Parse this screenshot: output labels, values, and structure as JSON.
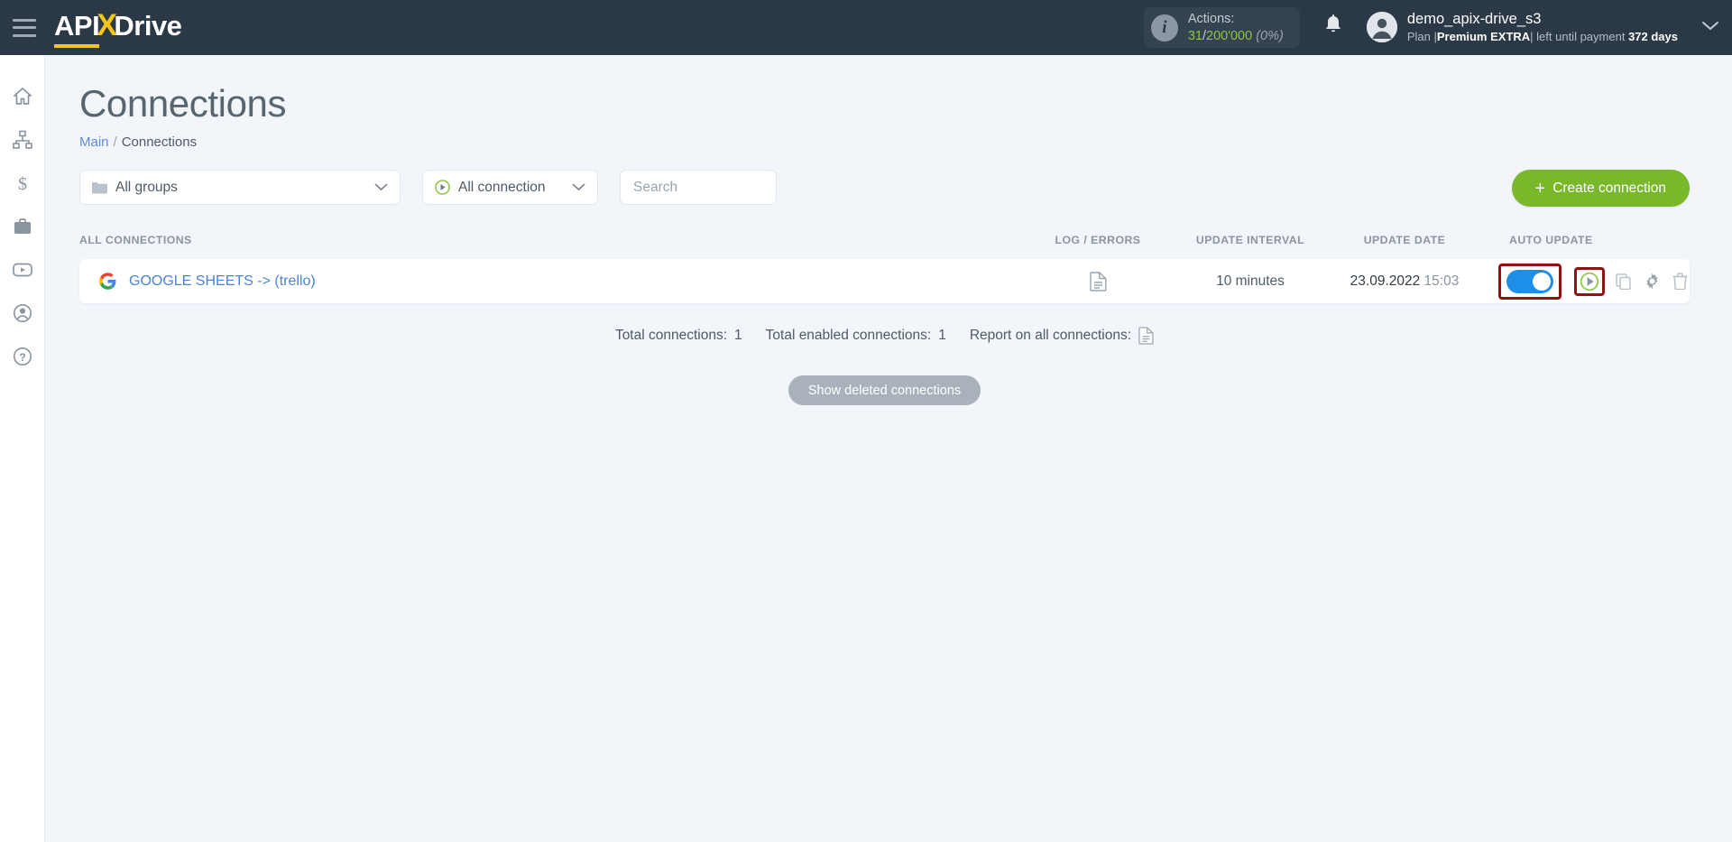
{
  "brand": {
    "part1": "API",
    "x": "X",
    "part2": "Drive",
    "accent": "#f5c518",
    "topbar_bg": "#2b3947"
  },
  "topbar": {
    "actions_label": "Actions:",
    "actions_used": "31",
    "actions_separator": "/",
    "actions_total": "200'000",
    "actions_percent": "(0%)",
    "user_name": "demo_apix-drive_s3",
    "plan_prefix": "Plan |",
    "plan_name": "Premium EXTRA",
    "plan_suffix": "| left until payment",
    "plan_days": "372 days"
  },
  "sidebar": {
    "items": [
      {
        "name": "home",
        "label": "Home"
      },
      {
        "name": "connections",
        "label": "Connections"
      },
      {
        "name": "billing",
        "label": "Billing"
      },
      {
        "name": "integrations",
        "label": "Integrations"
      },
      {
        "name": "video",
        "label": "Video"
      },
      {
        "name": "account",
        "label": "Account"
      },
      {
        "name": "help",
        "label": "Help"
      }
    ]
  },
  "page": {
    "title": "Connections",
    "breadcrumb_root": "Main",
    "breadcrumb_sep": "/",
    "breadcrumb_current": "Connections"
  },
  "filters": {
    "groups_label": "All groups",
    "connection_label": "All connection",
    "search_placeholder": "Search",
    "search_value": "",
    "create_button": "Create connection",
    "create_button_plus": "+",
    "create_button_color": "#78b82a"
  },
  "table": {
    "headers": {
      "name": "ALL CONNECTIONS",
      "log": "LOG / ERRORS",
      "interval": "UPDATE INTERVAL",
      "date": "UPDATE DATE",
      "auto": "AUTO UPDATE"
    },
    "rows": [
      {
        "name": "GOOGLE SHEETS -> (trello)",
        "source_icon": "google-icon",
        "interval": "10 minutes",
        "date": "23.09.2022",
        "time": "15:03",
        "auto_update_on": true
      }
    ]
  },
  "totals": {
    "total_connections_label": "Total connections:",
    "total_connections_value": "1",
    "total_enabled_label": "Total enabled connections:",
    "total_enabled_value": "1",
    "report_label": "Report on all connections:"
  },
  "footer": {
    "show_deleted": "Show deleted connections"
  },
  "highlights": {
    "color": "#8e1414",
    "toggle_note": "auto-update-toggle",
    "run_note": "run-now-button"
  }
}
